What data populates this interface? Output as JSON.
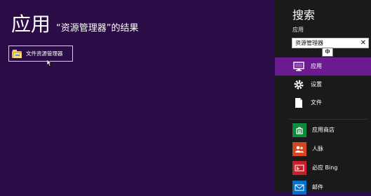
{
  "results": {
    "heading": "应用",
    "caption": "“资源管理器”的结果",
    "items": [
      {
        "label": "文件资源管理器",
        "icon": "folder-icon"
      }
    ]
  },
  "charm": {
    "title": "搜索",
    "scope": "应用",
    "search": {
      "value": "资源管理器",
      "clear": "✕"
    },
    "ime_indicator": "中",
    "categories": [
      {
        "label": "应用",
        "icon": "monitor-icon",
        "selected": true
      },
      {
        "label": "设置",
        "icon": "gear-icon",
        "selected": false
      },
      {
        "label": "文件",
        "icon": "file-icon",
        "selected": false
      }
    ],
    "apps": [
      {
        "label": "应用商店",
        "icon": "store-icon",
        "color": "#0f8a3c"
      },
      {
        "label": "人脉",
        "icon": "people-icon",
        "color": "#d24726"
      },
      {
        "label": "必应 Bing",
        "icon": "bing-icon",
        "color": "#c8202a"
      },
      {
        "label": "邮件",
        "icon": "mail-icon",
        "color": "#0072c6"
      }
    ]
  },
  "colors": {
    "background": "#2b0c46",
    "charm": "#1a1a1a",
    "selection": "#6a1b8f"
  }
}
